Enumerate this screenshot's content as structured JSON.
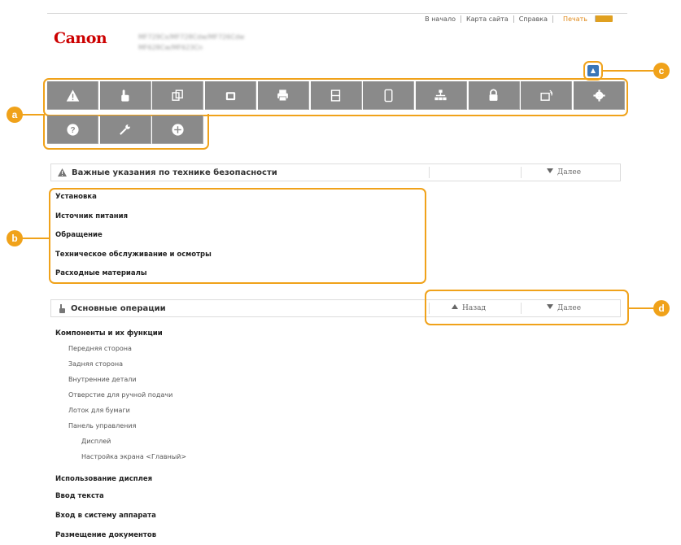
{
  "header": {
    "nav": [
      "В начало",
      "Карта сайта",
      "Справка"
    ],
    "print": "Печать",
    "logo": "Canon",
    "model_line1": "MF729Cx/MF728Cdw/MF726Cdw",
    "model_line2": "MF628Cw/MF623Cn"
  },
  "toolbar": {
    "icons": [
      "warning-icon",
      "hand-icon",
      "copy-icon",
      "fax-icon",
      "print-icon",
      "scan-icon",
      "mobile-icon",
      "network-icon",
      "security-icon",
      "remote-ui-icon",
      "settings-icon",
      "help-icon",
      "wrench-icon",
      "plus-icon"
    ]
  },
  "callouts": {
    "a": "a",
    "b": "b",
    "c": "c",
    "d": "d"
  },
  "section1": {
    "title": "Важные указания по технике безопасности",
    "next": "Далее",
    "links": [
      "Установка",
      "Источник питания",
      "Обращение",
      "Техническое обслуживание и осмотры",
      "Расходные материалы"
    ]
  },
  "section2": {
    "title": "Основные операции",
    "back": "Назад",
    "next": "Далее",
    "items": [
      {
        "text": "Компоненты и их функции",
        "level": 0
      },
      {
        "text": "Передняя сторона",
        "level": 1
      },
      {
        "text": "Задняя сторона",
        "level": 1
      },
      {
        "text": "Внутренние детали",
        "level": 1
      },
      {
        "text": "Отверстие для ручной подачи",
        "level": 1
      },
      {
        "text": "Лоток для бумаги",
        "level": 1
      },
      {
        "text": "Панель управления",
        "level": 1
      },
      {
        "text": "Дисплей",
        "level": 2
      },
      {
        "text": "Настройка экрана <Главный>",
        "level": 2
      },
      {
        "text": "Использование дисплея",
        "level": 0
      },
      {
        "text": "Ввод текста",
        "level": 0
      },
      {
        "text": "Вход в систему аппарата",
        "level": 0
      },
      {
        "text": "Размещение документов",
        "level": 0
      }
    ]
  },
  "colors": {
    "accent": "#f0a21a",
    "toolbar": "#8a8a8a",
    "brand": "#cc0000",
    "toc_button": "#3a76b8"
  }
}
